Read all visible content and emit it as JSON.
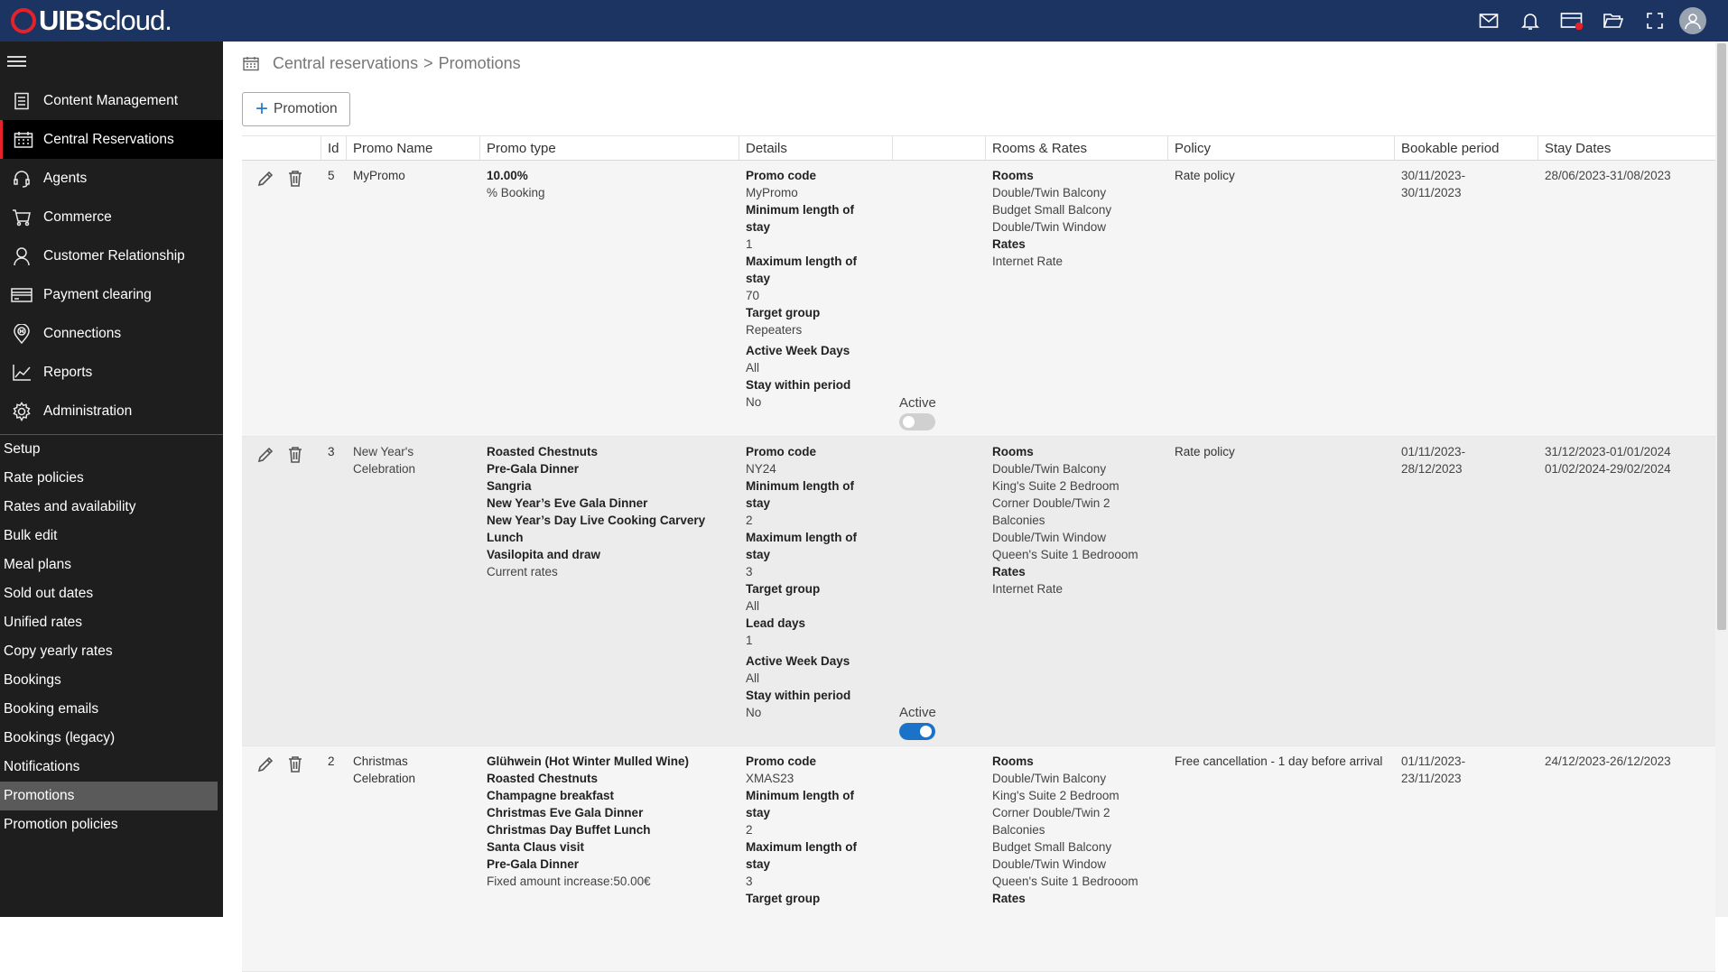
{
  "brand": {
    "uibs": "UIBS",
    "cloud": "cloud."
  },
  "sidebar": {
    "menu": [
      {
        "label": "Content Management",
        "icon": "document-icon"
      },
      {
        "label": "Central Reservations",
        "icon": "calendar-icon"
      },
      {
        "label": "Agents",
        "icon": "headset-icon"
      },
      {
        "label": "Commerce",
        "icon": "cart-icon"
      },
      {
        "label": "Customer Relationship",
        "icon": "user-icon"
      },
      {
        "label": "Payment clearing",
        "icon": "card-icon"
      },
      {
        "label": "Connections",
        "icon": "location-pin-icon"
      },
      {
        "label": "Reports",
        "icon": "chart-line-icon"
      },
      {
        "label": "Administration",
        "icon": "gear-icon"
      }
    ],
    "active_menu": "Central Reservations",
    "submenu": [
      "Setup",
      "Rate policies",
      "Rates and availability",
      "Bulk edit",
      "Meal plans",
      "Sold out dates",
      "Unified rates",
      "Copy yearly rates",
      "Bookings",
      "Booking emails",
      "Bookings (legacy)",
      "Notifications",
      "Promotions",
      "Promotion policies"
    ],
    "active_submenu": "Promotions"
  },
  "breadcrumb": {
    "section": "Central reservations",
    "separator": ">",
    "page": "Promotions"
  },
  "add_button": {
    "label": "Promotion"
  },
  "table": {
    "headers": [
      "",
      "Id",
      "Promo Name",
      "Promo type",
      "Details",
      "",
      "Rooms & Rates",
      "Policy",
      "Bookable period",
      "Stay Dates"
    ],
    "rows": [
      {
        "id": "5",
        "name": "MyPromo",
        "promo_type_bold": [
          "10.00%"
        ],
        "promo_type_text": [
          "% Booking"
        ],
        "promo_type_note": "",
        "details": {
          "promo_code_label": "Promo code",
          "promo_code": "MyPromo",
          "min_label_1": "Minimum length of",
          "min_label_2": "stay",
          "min": "1",
          "max_label_1": "Maximum length of",
          "max_label_2": "stay",
          "max": "70",
          "target_label": "Target group",
          "target": "Repeaters",
          "week_label": "Active Week Days",
          "week": "All",
          "within_label": "Stay within period",
          "within": "No"
        },
        "active_label": "Active",
        "active": false,
        "rooms_label": "Rooms",
        "rooms": [
          "Double/Twin Balcony",
          "Budget Small Balcony",
          "Double/Twin Window"
        ],
        "rates_label": "Rates",
        "rates": [
          "Internet Rate"
        ],
        "policy": "Rate policy",
        "bookable_1": "30/11/2023-",
        "bookable_2": "30/11/2023",
        "stay_dates": [
          "28/06/2023-31/08/2023"
        ]
      },
      {
        "id": "3",
        "name_1": "New Year's",
        "name_2": "Celebration",
        "promo_type_bold": [
          "Roasted Chestnuts",
          "Pre-Gala Dinner",
          "Sangria",
          "New Year’s Eve Gala Dinner",
          "New Year’s Day Live Cooking Carvery",
          "Lunch",
          "Vasilopita and draw"
        ],
        "promo_type_note": "Current rates",
        "details": {
          "promo_code_label": "Promo code",
          "promo_code": "NY24",
          "min_label_1": "Minimum length of",
          "min_label_2": "stay",
          "min": "2",
          "max_label_1": "Maximum length of",
          "max_label_2": "stay",
          "max": "3",
          "target_label": "Target group",
          "target": "All",
          "lead_label": "Lead days",
          "lead": "1",
          "week_label": "Active Week Days",
          "week": "All",
          "within_label": "Stay within period",
          "within": "No"
        },
        "active_label": "Active",
        "active": true,
        "rooms_label": "Rooms",
        "rooms": [
          "Double/Twin Balcony",
          "King's Suite 2 Bedroom",
          "Corner Double/Twin 2",
          "Balconies",
          "Double/Twin Window",
          "Queen's Suite 1 Bedrooom"
        ],
        "rates_label": "Rates",
        "rates": [
          "Internet Rate"
        ],
        "policy": "Rate policy",
        "bookable_1": "01/11/2023-",
        "bookable_2": "28/12/2023",
        "stay_dates": [
          "31/12/2023-01/01/2024",
          "01/02/2024-29/02/2024"
        ]
      },
      {
        "id": "2",
        "name": "Christmas Celebration",
        "promo_type_bold": [
          "Glühwein (Hot Winter Mulled Wine)",
          "Roasted Chestnuts",
          "Champagne breakfast",
          "Christmas Eve Gala Dinner",
          "Christmas Day Buffet Lunch",
          "Santa Claus visit",
          "Pre-Gala Dinner"
        ],
        "promo_type_note": "Fixed amount increase:50.00€",
        "details": {
          "promo_code_label": "Promo code",
          "promo_code": "XMAS23",
          "min_label_1": "Minimum length of",
          "min_label_2": "stay",
          "min": "2",
          "max_label_1": "Maximum length of",
          "max_label_2": "stay",
          "max": "3",
          "target_label": "Target group"
        },
        "rooms_label": "Rooms",
        "rooms": [
          "Double/Twin Balcony",
          "King's Suite 2 Bedroom",
          "Corner Double/Twin 2",
          "Balconies",
          "Budget Small Balcony",
          "Double/Twin Window",
          "Queen's Suite 1 Bedrooom"
        ],
        "rates_label": "Rates",
        "policy": "Free cancellation - 1 day before arrival",
        "bookable_1": "01/11/2023-",
        "bookable_2": "23/11/2023",
        "stay_dates": [
          "24/12/2023-26/12/2023"
        ]
      }
    ]
  },
  "top_icons": [
    "mail-icon",
    "bell-icon",
    "card-alert-icon",
    "folder-open-icon",
    "fullscreen-icon",
    "account-icon"
  ]
}
